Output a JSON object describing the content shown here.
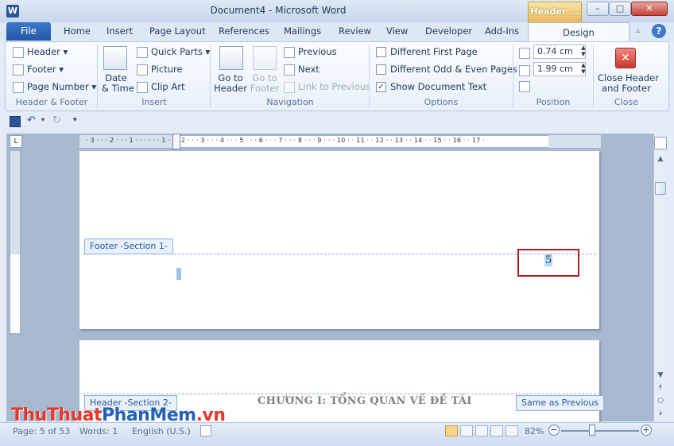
{
  "window": {
    "title": "Document4  -  Microsoft Word",
    "app_icon": "W",
    "context_tab": "Header ...",
    "minimize": "–",
    "maximize": "□",
    "close": "✕"
  },
  "tabs": [
    "File",
    "Home",
    "Insert",
    "Page Layout",
    "References",
    "Mailings",
    "Review",
    "View",
    "Developer",
    "Add-Ins",
    "Design"
  ],
  "help": "?",
  "ribbon": {
    "header_footer": {
      "header": "Header",
      "footer": "Footer",
      "page_number": "Page Number",
      "label": "Header & Footer"
    },
    "insert": {
      "date_time_1": "Date",
      "date_time_2": "& Time",
      "quick_parts": "Quick Parts",
      "picture": "Picture",
      "clip_art": "Clip Art",
      "label": "Insert"
    },
    "navigation": {
      "goto_header_1": "Go to",
      "goto_header_2": "Header",
      "goto_footer_1": "Go to",
      "goto_footer_2": "Footer",
      "previous": "Previous",
      "next": "Next",
      "link_previous": "Link to Previous",
      "label": "Navigation"
    },
    "options": {
      "first_page": "Different First Page",
      "odd_even": "Different Odd & Even Pages",
      "show_text": "Show Document Text",
      "show_text_checked": "✓",
      "label": "Options"
    },
    "position": {
      "header_pos": "0.74 cm",
      "footer_pos": "1.99 cm",
      "label": "Position"
    },
    "close": {
      "close_1": "Close Header",
      "close_2": "and Footer",
      "label": "Close"
    }
  },
  "ruler": {
    "corner": "L",
    "h_text": "· 3 · · · 2 · · · 1 · · ·  · · · 1 · · · 2 · · · 3 · · · 4 · · · 5 · · · 6 · · · 7 · · · 8 · · · 9 · · · 10 · · 11 · · 12 · · 13 · · 14 · · 15 · · 16 · · 17 ·"
  },
  "document": {
    "footer_tag": "Footer -Section 1-",
    "page_number": "5",
    "header_tag": "Header -Section 2-",
    "same_as_previous": "Same as Previous",
    "chapter_title": "CHƯƠNG I: TỔNG QUAN VỀ ĐỀ TÀI"
  },
  "status": {
    "page": "Page: 5 of 53",
    "words": "Words: 1",
    "language": "English (U.S.)",
    "zoom": "82%",
    "zoom_out": "−",
    "zoom_in": "+",
    "zoom_level": 0.4
  },
  "watermark": {
    "part1": "ThuThuat",
    "part2": "PhanMem",
    "part3": ".vn"
  },
  "colors": {
    "accent": "#2b579a",
    "highlight_box": "#b12020",
    "context_tab": "#eab75a"
  }
}
